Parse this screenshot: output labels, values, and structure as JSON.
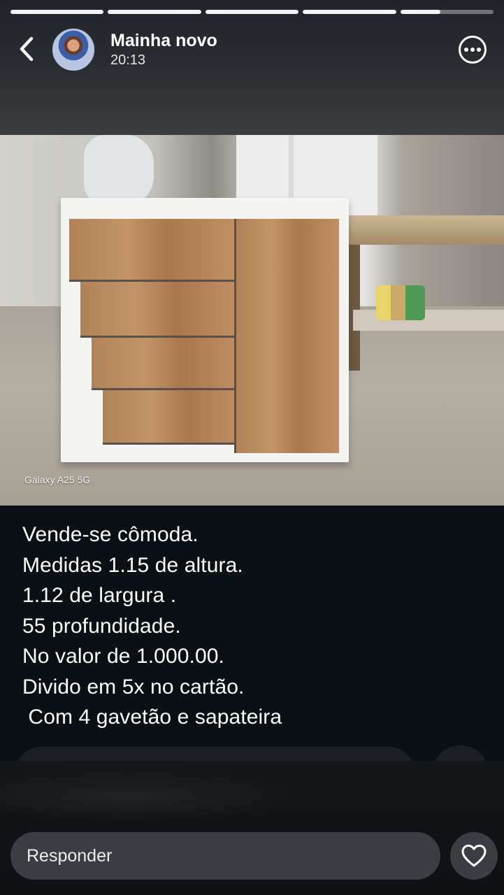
{
  "story": {
    "progress": [
      1,
      1,
      1,
      1,
      0.43
    ],
    "header": {
      "name": "Mainha novo",
      "time": "20:13"
    },
    "photo": {
      "watermark": "Galaxy A25 5G"
    },
    "caption": [
      "Vende-se cômoda.",
      "Medidas 1.15 de altura.",
      "1.12 de largura .",
      "55 profundidade.",
      "No valor de 1.000.00.",
      "Divido em 5x no cartão.",
      " Com 4 gavetão e sapateira"
    ],
    "reply": {
      "placeholder": "Responder"
    },
    "icons": {
      "back": "chevron-left-icon",
      "more": "more-options-icon",
      "like": "heart-icon"
    }
  }
}
